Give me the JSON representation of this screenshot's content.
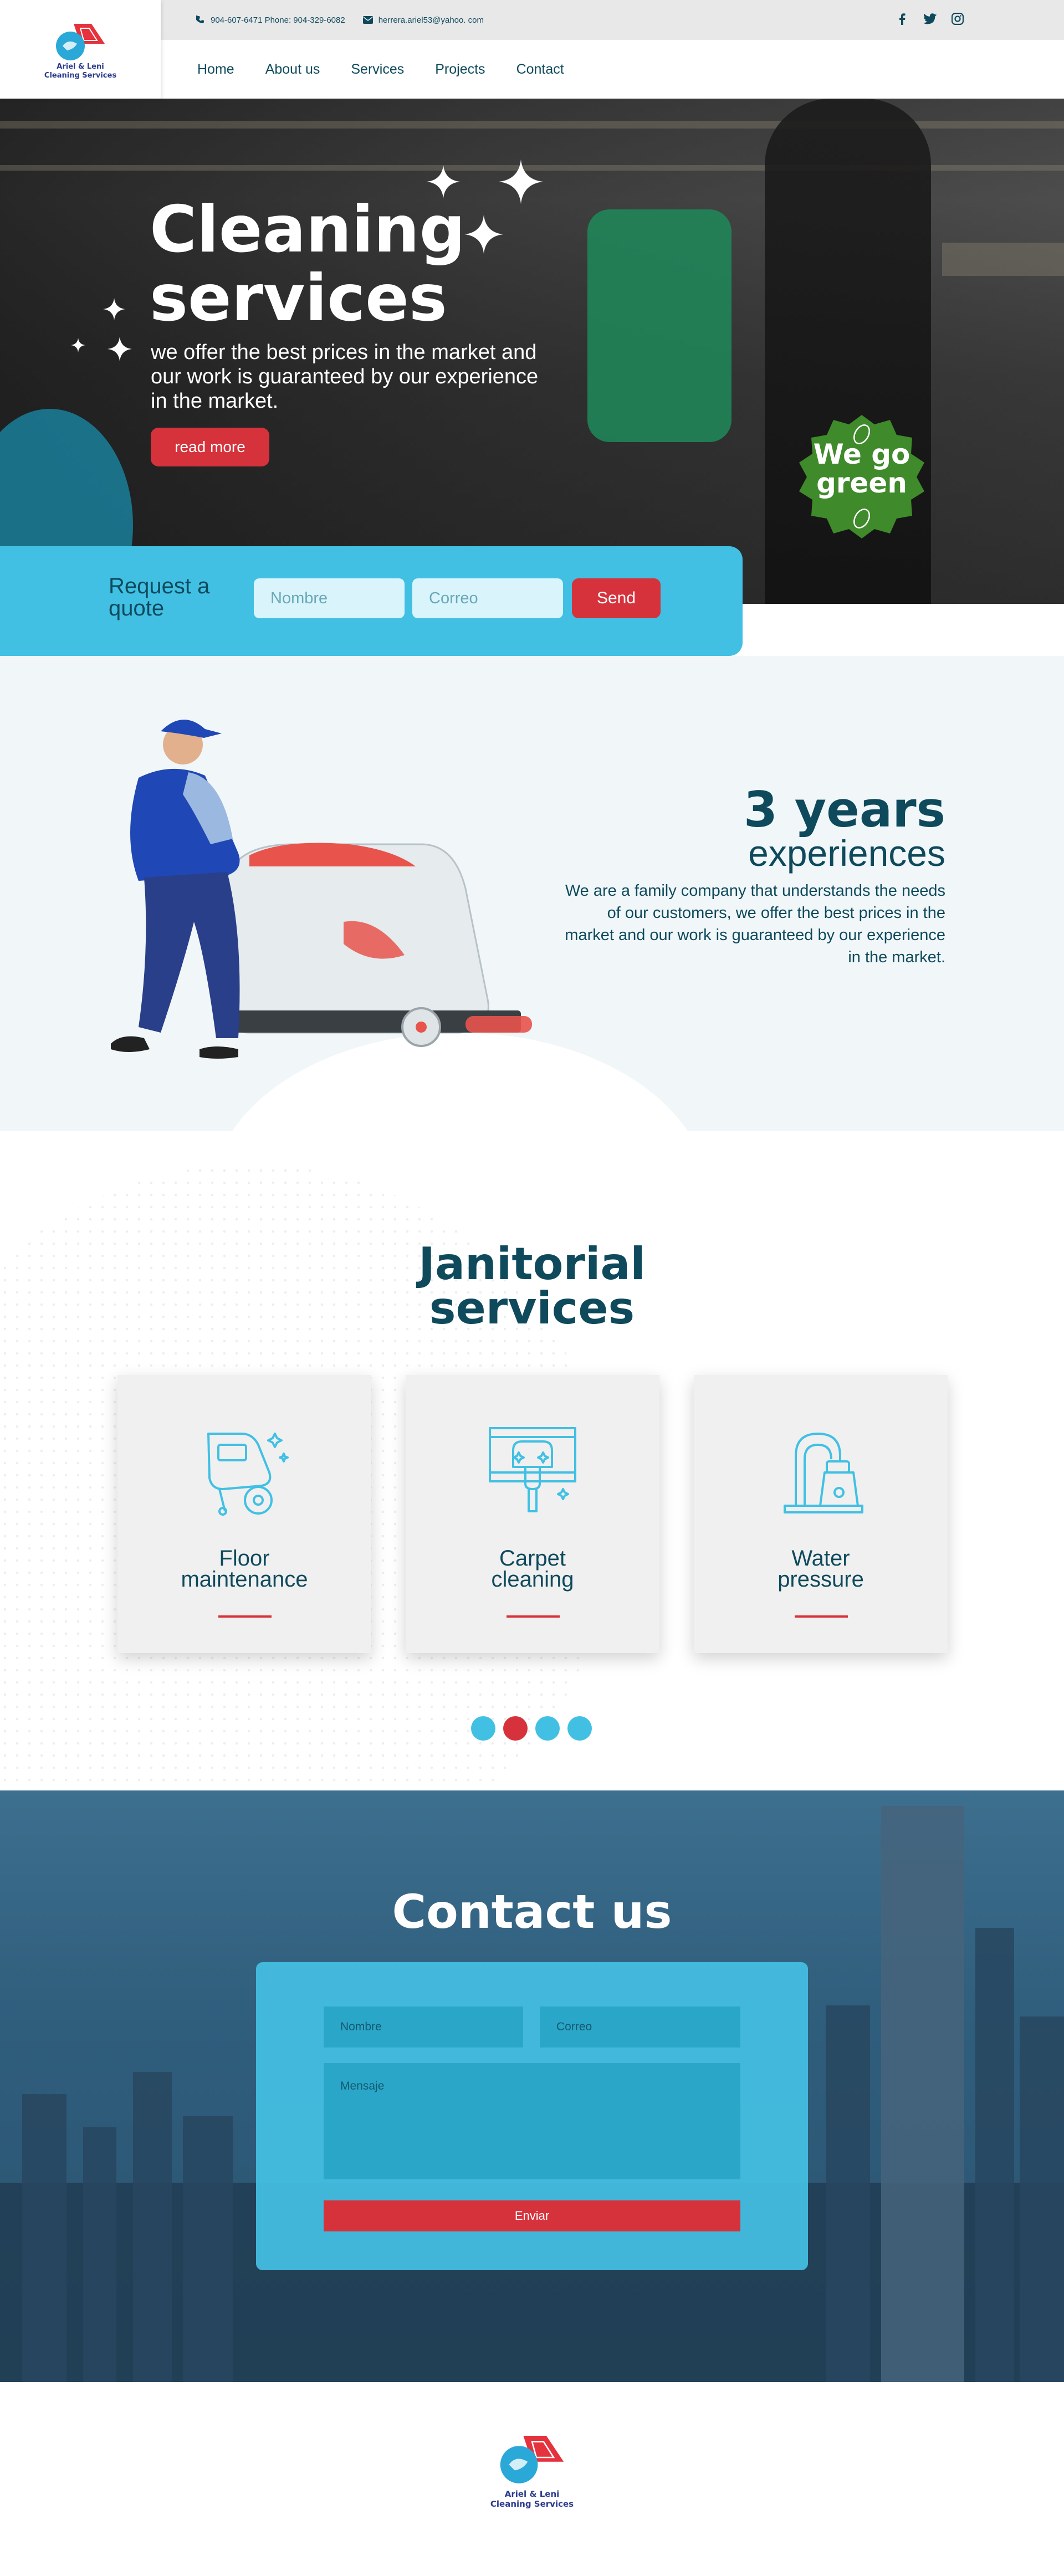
{
  "brand": {
    "name_line1": "Ariel & Leni",
    "name_line2": "Cleaning Services"
  },
  "topbar": {
    "phone": "904-607-6471 Phone: 904-329-6082",
    "email": "herrera.ariel53@yahoo. com",
    "social": [
      "facebook-icon",
      "twitter-icon",
      "instagram-icon"
    ]
  },
  "nav": {
    "items": [
      "Home",
      "About us",
      "Services",
      "Projects",
      "Contact"
    ]
  },
  "hero": {
    "title_line1": "Cleaning",
    "title_line2": "services",
    "subtitle": "we offer the best prices in the market and our work is guaranteed by our experience in the market.",
    "button": "read more",
    "badge_line1": "We go",
    "badge_line2": "green"
  },
  "quote": {
    "label_line1": "Request a",
    "label_line2": "quote",
    "name_placeholder": "Nombre",
    "email_placeholder": "Correo",
    "send": "Send"
  },
  "experience": {
    "title": "3 years",
    "subtitle": "experiences",
    "text": "We are a family company that understands the needs of our customers, we offer the best prices in the market and our work is guaranteed by our experience in the market."
  },
  "janitorial": {
    "title_line1": "Janitorial",
    "title_line2": "services",
    "cards": [
      {
        "line1": "Floor",
        "line2": "maintenance",
        "icon": "floor-scrubber-icon"
      },
      {
        "line1": "Carpet",
        "line2": "cleaning",
        "icon": "carpet-cleaner-icon"
      },
      {
        "line1": "Water",
        "line2": "pressure",
        "icon": "pressure-washer-icon"
      }
    ],
    "carousel_active_index": 1,
    "carousel_count": 4
  },
  "contact": {
    "title": "Contact us",
    "name_placeholder": "Nombre",
    "email_placeholder": "Correo",
    "message_placeholder": "Mensaje",
    "send": "Enviar"
  },
  "colors": {
    "primary_dark": "#0e4a5c",
    "accent_blue": "#41c0e4",
    "accent_red": "#d6323c",
    "green_badge": "#3f8a2a"
  }
}
